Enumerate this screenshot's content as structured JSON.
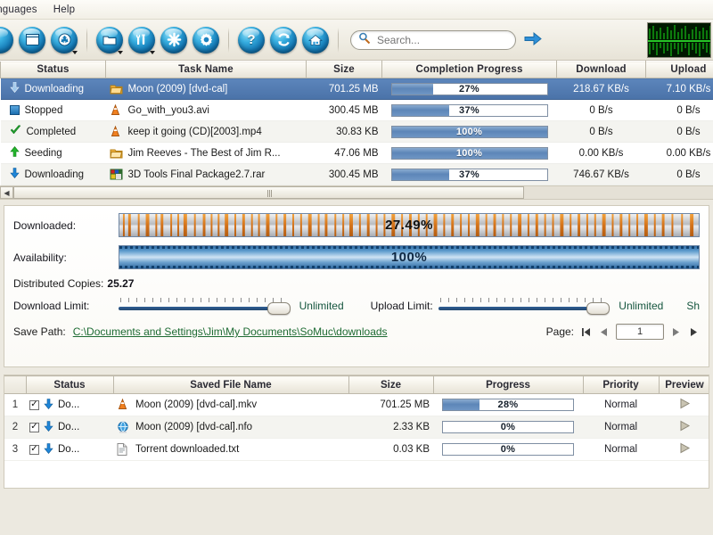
{
  "menubar": {
    "items": [
      {
        "label": "Languages"
      },
      {
        "label": "Help"
      }
    ]
  },
  "toolbar": {
    "buttons": [
      {
        "name": "open-orb",
        "icon": "circle-icon",
        "glyph": "",
        "dropdown": false
      },
      {
        "name": "new-task",
        "icon": "window-icon",
        "glyph": "",
        "dropdown": false
      },
      {
        "name": "delete-task",
        "icon": "recycle-bin-icon",
        "glyph": "",
        "dropdown": true
      },
      {
        "name": "open-folder",
        "icon": "folder-icon",
        "glyph": "",
        "dropdown": true
      },
      {
        "name": "tools",
        "icon": "wrench-icon",
        "glyph": "",
        "dropdown": true
      },
      {
        "name": "connection",
        "icon": "asterisk-icon",
        "glyph": "",
        "dropdown": false
      },
      {
        "name": "settings",
        "icon": "gear-icon",
        "glyph": "",
        "dropdown": false
      },
      {
        "name": "help",
        "icon": "question-icon",
        "glyph": "?",
        "dropdown": false
      },
      {
        "name": "refresh",
        "icon": "refresh-icon",
        "glyph": "",
        "dropdown": false
      },
      {
        "name": "home",
        "icon": "home-icon",
        "glyph": "",
        "dropdown": false
      }
    ],
    "search": {
      "placeholder": "Search...",
      "value": ""
    }
  },
  "task_table": {
    "columns": [
      "Status",
      "Task Name",
      "Size",
      "Completion Progress",
      "Download",
      "Upload"
    ],
    "rows": [
      {
        "status": "Downloading",
        "status_icon": "arrow-down-icon",
        "name": "Moon (2009) [dvd-cal]",
        "file_icon": "archive-icon",
        "size": "701.25 MB",
        "progress": 27,
        "progress_label": "27%",
        "download": "218.67 KB/s",
        "upload": "7.10 KB/s",
        "selected": true
      },
      {
        "status": "Stopped",
        "status_icon": "stop-square-icon",
        "name": "Go_with_you3.avi",
        "file_icon": "vlc-cone-icon",
        "size": "300.45 MB",
        "progress": 37,
        "progress_label": "37%",
        "download": "0 B/s",
        "upload": "0 B/s",
        "selected": false
      },
      {
        "status": "Completed",
        "status_icon": "check-icon",
        "name": "keep it going (CD)[2003].mp4",
        "file_icon": "vlc-cone-icon",
        "size": "30.83 KB",
        "progress": 100,
        "progress_label": "100%",
        "download": "0 B/s",
        "upload": "0 B/s",
        "selected": false
      },
      {
        "status": "Seeding",
        "status_icon": "arrow-up-icon",
        "name": "Jim Reeves - The Best of Jim R...",
        "file_icon": "archive-icon",
        "size": "47.06 MB",
        "progress": 100,
        "progress_label": "100%",
        "download": "0.00 KB/s",
        "upload": "0.00 KB/s",
        "selected": false
      },
      {
        "status": "Downloading",
        "status_icon": "arrow-down-icon",
        "name": "3D Tools Final Package2.7.rar",
        "file_icon": "image-icon",
        "size": "300.45 MB",
        "progress": 37,
        "progress_label": "37%",
        "download": "746.67 KB/s",
        "upload": "0 B/s",
        "selected": false
      }
    ]
  },
  "detail": {
    "downloaded_label": "Downloaded:",
    "downloaded_pct": "27.49%",
    "availability_label": "Availability:",
    "availability_pct": "100%",
    "distributed_copies_label": "Distributed Copies:",
    "distributed_copies_value": "25.27",
    "download_limit_label": "Download Limit:",
    "download_limit_value": "Unlimited",
    "upload_limit_label": "Upload Limit:",
    "upload_limit_value": "Unlimited",
    "share_label_clipped": "Sh",
    "save_path_label": "Save Path:",
    "save_path_value": "C:\\Documents and Settings\\Jim\\My Documents\\SoMuc\\downloads",
    "page_label": "Page:",
    "page_value": "1"
  },
  "file_table": {
    "columns": [
      "",
      "Status",
      "Saved File Name",
      "Size",
      "Progress",
      "Priority",
      "Preview"
    ],
    "rows": [
      {
        "num": "1",
        "checked": true,
        "status": "Do...",
        "status_icon": "arrow-down-icon",
        "name": "Moon  (2009) [dvd-cal].mkv",
        "file_icon": "vlc-cone-icon",
        "size": "701.25 MB",
        "progress": 28,
        "progress_label": "28%",
        "priority": "Normal",
        "preview_icon": "play-icon"
      },
      {
        "num": "2",
        "checked": true,
        "status": "Do...",
        "status_icon": "arrow-down-icon",
        "name": "Moon (2009) [dvd-cal].nfo",
        "file_icon": "globe-icon",
        "size": "2.33 KB",
        "progress": 0,
        "progress_label": "0%",
        "priority": "Normal",
        "preview_icon": "play-icon"
      },
      {
        "num": "3",
        "checked": true,
        "status": "Do...",
        "status_icon": "arrow-down-icon",
        "name": "Torrent downloaded.txt",
        "file_icon": "text-file-icon",
        "size": "0.03 KB",
        "progress": 0,
        "progress_label": "0%",
        "priority": "Normal",
        "preview_icon": "play-icon"
      }
    ]
  },
  "colors": {
    "accent_blue": "#5d86b8",
    "selection_blue": "#4a72a8",
    "chrome": "#ece9e0",
    "link_green": "#1e6b33",
    "graph_green": "#27c427",
    "stripe_orange": "#e08a1e"
  }
}
